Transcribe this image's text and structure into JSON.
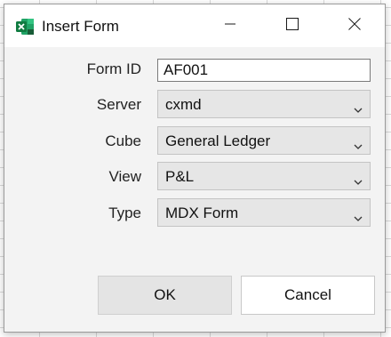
{
  "window": {
    "title": "Insert Form",
    "app_icon": "excel-icon",
    "controls": [
      "minimize-icon",
      "maximize-icon",
      "close-icon"
    ]
  },
  "form": {
    "form_id": {
      "label": "Form ID",
      "value": "AF001"
    },
    "server": {
      "label": "Server",
      "value": "cxmd"
    },
    "cube": {
      "label": "Cube",
      "value": "General Ledger"
    },
    "view": {
      "label": "View",
      "value": "P&L"
    },
    "type": {
      "label": "Type",
      "value": "MDX Form"
    }
  },
  "buttons": {
    "ok": "OK",
    "cancel": "Cancel"
  },
  "colors": {
    "excel_green": "#107c41",
    "dialog_bg": "#f3f3f3",
    "dropdown_bg": "#e6e6e6"
  }
}
